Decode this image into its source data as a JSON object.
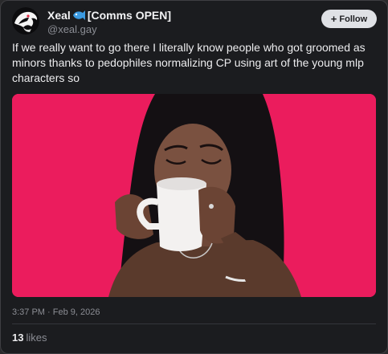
{
  "post": {
    "author": {
      "display_name_before_emoji": "Xeal",
      "emoji_icon": "fish-emoji-icon",
      "display_name_after_emoji": "[Comms OPEN]",
      "handle": "@xeal.gay"
    },
    "follow_button": {
      "icon": "plus-icon",
      "label": "Follow"
    },
    "text": "If we really want to go there I literally know people who got groomed as minors thanks to pedophiles normalizing CP using art of the young mlp characters so",
    "media": {
      "type": "animated-gif",
      "background_color": "#eb1c5d"
    },
    "timestamp": "3:37 PM · Feb 9, 2026",
    "likes": {
      "count": "13",
      "label": "likes"
    }
  },
  "colors": {
    "card_background": "#1b1c1f",
    "follow_button_background": "#dfe1e5",
    "secondary_text": "#8b8d94",
    "primary_text": "#ececee"
  }
}
